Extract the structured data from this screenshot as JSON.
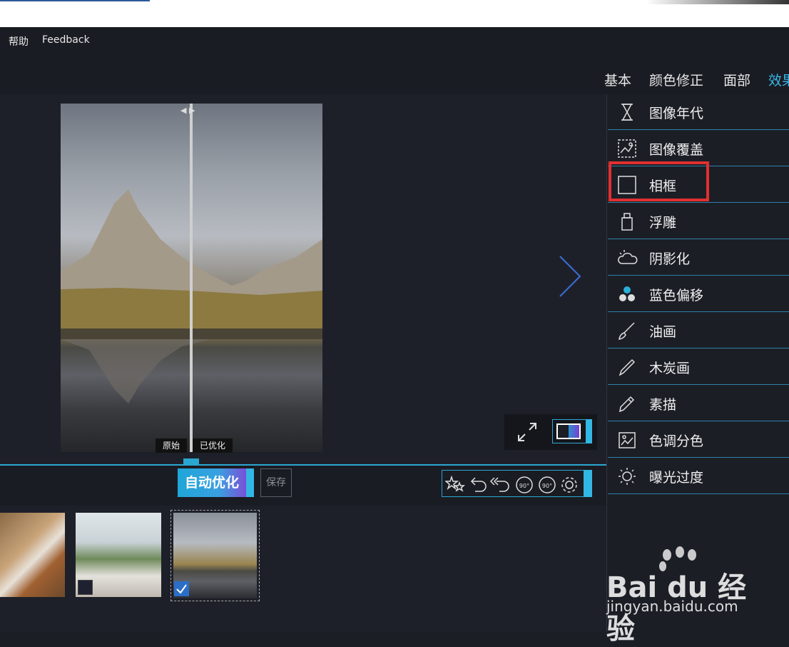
{
  "menu": {
    "help": "帮助",
    "feedback": "Feedback"
  },
  "tabs": [
    {
      "label": "基本"
    },
    {
      "label": "颜色修正"
    },
    {
      "label": "面部"
    },
    {
      "label": "效果"
    }
  ],
  "preview": {
    "label_original": "原始",
    "label_optimized": "已优化"
  },
  "actions": {
    "auto_optimize": "自动优化",
    "save": "保存"
  },
  "tool_icons": [
    "stars-icon",
    "undo-icon",
    "undo-all-icon",
    "rotate-left-90-icon",
    "rotate-right-90-icon",
    "settings-icon"
  ],
  "rotate_label": "90°",
  "panel_items": [
    {
      "label": "图像年代",
      "icon": "hourglass-icon"
    },
    {
      "label": "图像覆盖",
      "icon": "image-overlay-icon"
    },
    {
      "label": "相框",
      "icon": "frame-icon"
    },
    {
      "label": "浮雕",
      "icon": "emboss-icon"
    },
    {
      "label": "阴影化",
      "icon": "cloud-sun-icon"
    },
    {
      "label": "蓝色偏移",
      "icon": "color-dots-icon"
    },
    {
      "label": "油画",
      "icon": "brush-icon"
    },
    {
      "label": "木炭画",
      "icon": "charcoal-icon"
    },
    {
      "label": "素描",
      "icon": "pencil-icon"
    },
    {
      "label": "色调分色",
      "icon": "tone-image-icon"
    },
    {
      "label": "曝光过度",
      "icon": "sun-icon"
    }
  ],
  "watermark": {
    "brand": "Bai du 经验",
    "url": "jingyan.baidu.com"
  },
  "colors": {
    "accent": "#38b8e8",
    "highlight": "#e03030",
    "background": "#1c1e26"
  }
}
